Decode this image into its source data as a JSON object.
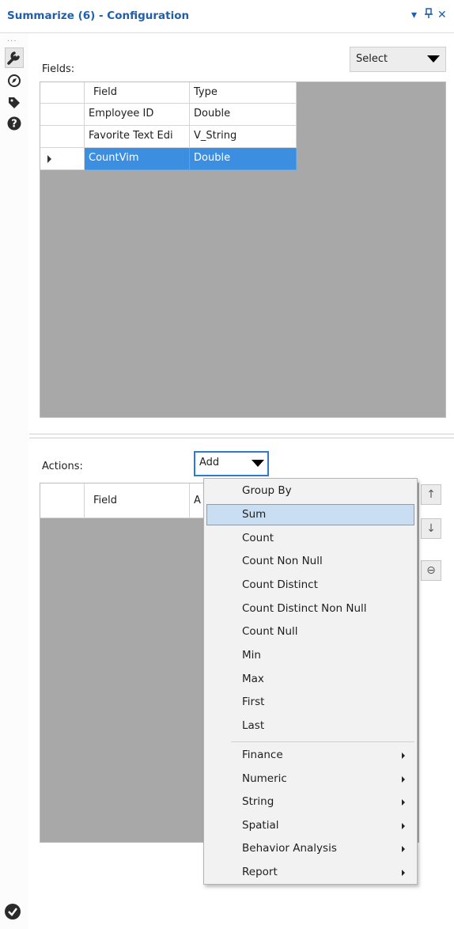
{
  "window": {
    "title": "Summarize (6) - Configuration",
    "dropdown_glyph": "▾",
    "pin_glyph": "⊥",
    "close_glyph": "✕"
  },
  "sidebar": {
    "dots": "...",
    "icons": [
      "wrench-icon",
      "compass-icon",
      "tag-icon",
      "help-icon"
    ]
  },
  "fields_panel": {
    "label": "Fields:",
    "select_dropdown": "Select",
    "columns": [
      "Field",
      "Type"
    ],
    "rows": [
      {
        "field": "Employee ID",
        "type": "Double"
      },
      {
        "field": "Favorite Text Edi",
        "type": "V_String"
      },
      {
        "field": "CountVim",
        "type": "Double",
        "selected": true
      }
    ]
  },
  "actions_panel": {
    "label": "Actions:",
    "add_dropdown": "Add",
    "columns": [
      "Field",
      "A"
    ],
    "move_up_glyph": "↑",
    "move_down_glyph": "↓",
    "remove_glyph": "⊖"
  },
  "add_menu": {
    "items": [
      "Group By",
      "Sum",
      "Count",
      "Count Non Null",
      "Count Distinct",
      "Count Distinct Non Null",
      "Count Null",
      "Min",
      "Max",
      "First",
      "Last"
    ],
    "highlighted": "Sum",
    "submenus": [
      "Finance",
      "Numeric",
      "String",
      "Spatial",
      "Behavior Analysis",
      "Report"
    ]
  },
  "colors": {
    "title_blue": "#1f5fad",
    "selection_blue": "#3b8ee0",
    "grid_gray": "#a8a8a8",
    "menu_highlight": "#c9def3"
  }
}
